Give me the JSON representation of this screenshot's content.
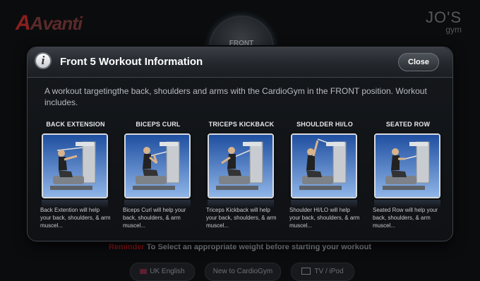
{
  "background": {
    "brand": "Avanti",
    "gym_name": "JO'S",
    "gym_sub": "gym",
    "dial_label": "FRONT",
    "notice_warning": "Reminder",
    "notice_text": "To Select an appropriate weight before starting your workout",
    "buttons": [
      {
        "label": "UK English"
      },
      {
        "label": "New to CardioGym"
      },
      {
        "label": "TV / iPod"
      }
    ]
  },
  "modal": {
    "title": "Front 5 Workout Information",
    "close_label": "Close",
    "description": "A workout targetingthe back, shoulders and arms with the CardioGym in the FRONT position. Workout includes.",
    "exercises": [
      {
        "title": "BACK EXTENSION",
        "description": "Back Extention will help your back, shoulders, & arm muscel..."
      },
      {
        "title": "BICEPS CURL",
        "description": "Biceps Curl will help your back, shoulders, & arm muscel..."
      },
      {
        "title": "TRICEPS KICKBACK",
        "description": "Triceps Kickback will help your back, shoulders, & arm muscel..."
      },
      {
        "title": "SHOULDER HI/LO",
        "description": "Shoulder HI/LO will help your back, shoulders, & arm muscel..."
      },
      {
        "title": "SEATED ROW",
        "description": "Seated Row will help your back, shoulders, & arm muscel..."
      }
    ]
  },
  "colors": {
    "accent_warning": "#8f1515",
    "thumb_bg_top": "#1f4fa0",
    "thumb_bg_bottom": "#8fb5e8"
  }
}
